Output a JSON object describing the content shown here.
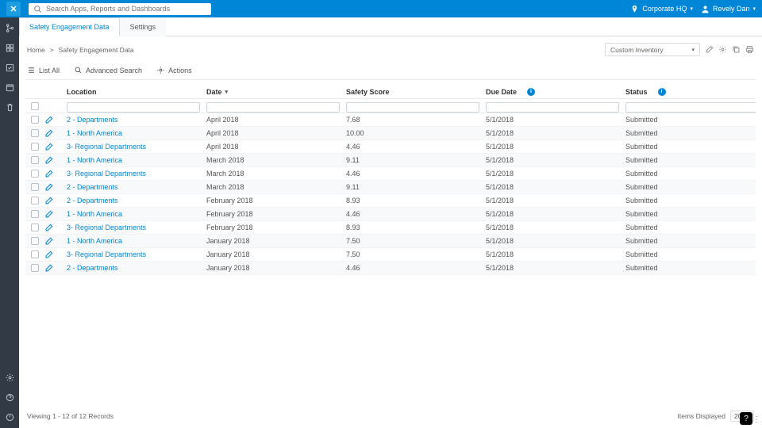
{
  "header": {
    "search_placeholder": "Search Apps, Reports and Dashboards",
    "location_label": "Corporate HQ",
    "user_name": "Revely Dan"
  },
  "tabs": [
    {
      "label": "Safety Engagement Data",
      "active": true
    },
    {
      "label": "Settings",
      "active": false
    }
  ],
  "breadcrumb": {
    "home": "Home",
    "sep": ">",
    "page": "Safety Engagement Data"
  },
  "view_select": "Custom Inventory",
  "toolbar": {
    "list_all": "List All",
    "adv_search": "Advanced Search",
    "actions": "Actions"
  },
  "columns": {
    "location": "Location",
    "date": "Date",
    "safety_score": "Safety Score",
    "due_date": "Due Date",
    "status": "Status"
  },
  "rows": [
    {
      "location": "2 - Departments",
      "date": "April 2018",
      "score": "7.68",
      "due": "5/1/2018",
      "status": "Submitted"
    },
    {
      "location": "1 - North America",
      "date": "April 2018",
      "score": "10.00",
      "due": "5/1/2018",
      "status": "Submitted"
    },
    {
      "location": "3- Regional Departments",
      "date": "April 2018",
      "score": "4.46",
      "due": "5/1/2018",
      "status": "Submitted"
    },
    {
      "location": "1 - North America",
      "date": "March 2018",
      "score": "9.11",
      "due": "5/1/2018",
      "status": "Submitted"
    },
    {
      "location": "3- Regional Departments",
      "date": "March 2018",
      "score": "4.46",
      "due": "5/1/2018",
      "status": "Submitted"
    },
    {
      "location": "2 - Departments",
      "date": "March 2018",
      "score": "9.11",
      "due": "5/1/2018",
      "status": "Submitted"
    },
    {
      "location": "2 - Departments",
      "date": "February 2018",
      "score": "8.93",
      "due": "5/1/2018",
      "status": "Submitted"
    },
    {
      "location": "1 - North America",
      "date": "February 2018",
      "score": "4.46",
      "due": "5/1/2018",
      "status": "Submitted"
    },
    {
      "location": "3- Regional Departments",
      "date": "February 2018",
      "score": "8.93",
      "due": "5/1/2018",
      "status": "Submitted"
    },
    {
      "location": "1 - North America",
      "date": "January 2018",
      "score": "7.50",
      "due": "5/1/2018",
      "status": "Submitted"
    },
    {
      "location": "3- Regional Departments",
      "date": "January 2018",
      "score": "7.50",
      "due": "5/1/2018",
      "status": "Submitted"
    },
    {
      "location": "2 - Departments",
      "date": "January 2018",
      "score": "4.46",
      "due": "5/1/2018",
      "status": "Submitted"
    }
  ],
  "footer": {
    "viewing": "Viewing 1 - 12 of 12 Records",
    "items_label": "Items Displayed",
    "page_size": "20"
  }
}
